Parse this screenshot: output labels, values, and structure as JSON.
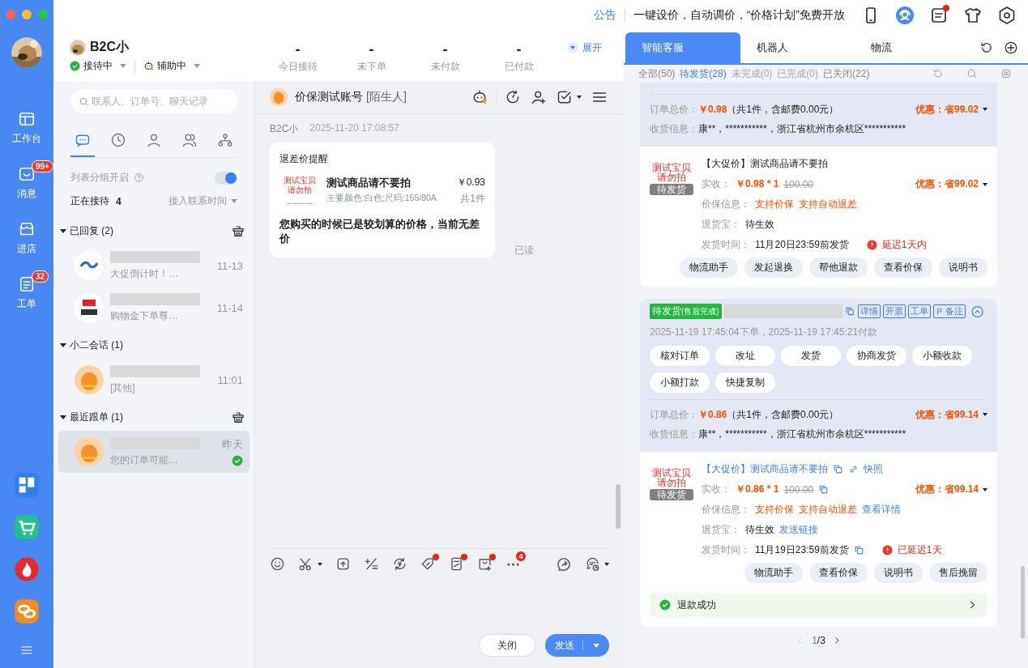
{
  "rail": {
    "items": [
      {
        "kind": "dashboard",
        "label": "工作台"
      },
      {
        "kind": "message",
        "label": "消息",
        "badge": "99+"
      },
      {
        "kind": "store",
        "label": "进店"
      },
      {
        "kind": "document",
        "label": "工单",
        "badge": "32"
      }
    ],
    "apps": [
      {
        "kind": "tiles"
      },
      {
        "kind": "cart"
      },
      {
        "kind": "fire"
      },
      {
        "kind": "chain"
      }
    ]
  },
  "topbar": {
    "link": "公告",
    "announcement": "一键设价，自动调价，“价格计划”免费开放",
    "tools": [
      {
        "kind": "phone",
        "dot": false
      },
      {
        "kind": "headset",
        "dot": false
      },
      {
        "kind": "news",
        "dot": true
      },
      {
        "kind": "shirt",
        "dot": false
      },
      {
        "kind": "settings",
        "dot": false
      }
    ]
  },
  "agent": {
    "name": "B2C小",
    "status": "接待中",
    "assist": "辅助中",
    "stats": [
      {
        "value": "-",
        "label": "今日接待"
      },
      {
        "value": "-",
        "label": "未下单"
      },
      {
        "value": "-",
        "label": "未付款"
      },
      {
        "value": "-",
        "label": "已付款"
      }
    ],
    "expand": "展开"
  },
  "contacts": {
    "search_placeholder": "联系人、订单号、聊天记录",
    "tabs": [
      {
        "kind": "chat-bubble",
        "selected": true
      },
      {
        "kind": "clock",
        "selected": false
      },
      {
        "kind": "person",
        "selected": false
      },
      {
        "kind": "people",
        "selected": false
      },
      {
        "kind": "network",
        "selected": false
      }
    ],
    "grouping": {
      "label": "列表分组开启",
      "on": true
    },
    "serving": {
      "label": "正在接待",
      "count": "4",
      "sort": "接入联系时间"
    },
    "groups": [
      {
        "title": "已回复 (2)",
        "expanded": true,
        "cleanable": true,
        "items": [
          {
            "kind": "logo-blue",
            "preview": "大促倒计时！…",
            "time": "11-13",
            "selected": false,
            "done": false
          },
          {
            "kind": "logo-red",
            "preview": "购物金下单尊…",
            "time": "11-14",
            "selected": false,
            "done": false
          }
        ]
      },
      {
        "title": "小二会话 (1)",
        "expanded": true,
        "cleanable": false,
        "items": [
          {
            "kind": "mascot",
            "preview": "[其他]",
            "time": "11:01",
            "selected": false,
            "done": false
          }
        ]
      },
      {
        "title": "最近跟单 (1)",
        "expanded": true,
        "cleanable": true,
        "items": [
          {
            "kind": "mascot",
            "preview": "您的订单可能…",
            "time": "昨天",
            "selected": true,
            "done": true
          }
        ]
      }
    ]
  },
  "chat": {
    "title": "价保测试账号",
    "tag": "[陌生人]",
    "tools": [
      {
        "kind": "robot",
        "dropdown": false
      },
      {
        "kind": "refresh",
        "dropdown": false
      },
      {
        "kind": "add-user",
        "dropdown": false
      },
      {
        "kind": "task-check",
        "dropdown": true
      },
      {
        "kind": "menu",
        "dropdown": false
      }
    ],
    "messages": [
      {
        "sender": "B2C小",
        "time": "2025-11-20 17:08:57",
        "card_title": "退差价提醒",
        "product": {
          "thumb_lines": [
            "测试宝贝",
            "请勿拍"
          ],
          "name": "测试商品请不要拍",
          "spec": "主要颜色:白色;尺码:155/80A",
          "price": "￥0.93",
          "qty": "共1件"
        },
        "text": "您购买的时候已是较划算的价格，当前无差价",
        "status": "已读"
      }
    ],
    "composer_tools": [
      {
        "kind": "smile",
        "dropdown": false,
        "dot": false
      },
      {
        "kind": "scissors",
        "dropdown": true,
        "dot": false
      },
      {
        "kind": "upload",
        "dropdown": false,
        "dot": false
      },
      {
        "kind": "calculator",
        "dropdown": false,
        "dot": false
      },
      {
        "kind": "exchange",
        "dropdown": false,
        "dot": false
      },
      {
        "kind": "tag",
        "dropdown": false,
        "dot": true
      },
      {
        "kind": "receipt",
        "dropdown": false,
        "dot": true
      },
      {
        "kind": "bag",
        "dropdown": false,
        "dot": true
      },
      {
        "kind": "more",
        "dropdown": false,
        "dot": false,
        "badge": "4"
      },
      {
        "kind": "share",
        "dropdown": false,
        "dot": false
      },
      {
        "kind": "schedule",
        "dropdown": true,
        "dot": false
      }
    ],
    "buttons": [
      {
        "label": "关闭",
        "kind": "secondary",
        "dropdown": false
      },
      {
        "label": "发送",
        "kind": "primary",
        "dropdown": true
      }
    ]
  },
  "orders_panel": {
    "tabs": [
      {
        "label": "智能客服",
        "selected": true
      },
      {
        "label": "机器人",
        "selected": false
      },
      {
        "label": "物流",
        "selected": false
      }
    ],
    "actions": [
      {
        "kind": "undo"
      },
      {
        "kind": "add-circle"
      }
    ],
    "filters": [
      {
        "label": "全部(50)",
        "selected": false,
        "disabled": false
      },
      {
        "label": "待发货(28)",
        "selected": true,
        "disabled": false
      },
      {
        "label": "未完成(0)",
        "selected": false,
        "disabled": true
      },
      {
        "label": "已完成(0)",
        "selected": false,
        "disabled": true
      },
      {
        "label": "已关闭(22)",
        "selected": false,
        "disabled": false
      }
    ],
    "filter_tools": [
      {
        "kind": "undo"
      },
      {
        "kind": "search"
      },
      {
        "kind": "list"
      }
    ],
    "orders": [
      {
        "summary": {
          "total_label": "订单总价：",
          "total": "￥0.98",
          "total_note": "（共1件，含邮费0.00元）",
          "discount": "优惠：省99.02",
          "address_label": "收货信息：",
          "address": "康**，***********，浙江省杭州市余杭区***********"
        },
        "item": {
          "thumb_lines": [
            "测试宝贝",
            "请勿拍"
          ],
          "thumb_status": "待发货",
          "title": "【大促价】测试商品请不要拍",
          "title_link": false,
          "copy_icons": false,
          "paid_label": "实收：",
          "paid": "￥0.98 * 1",
          "original": "100.00",
          "discount": "优惠：省99.02",
          "protect_label": "价保信息：",
          "protect_tags": [
            "支持价保",
            "支持自动退差"
          ],
          "return_label": "退货宝：",
          "return_status": "待生效",
          "ship_label": "发货时间：",
          "ship": "11月20日23:59前发货",
          "delay": "延迟1天内",
          "buttons": [
            "物流助手",
            "发起退换",
            "帮他退款",
            "查看价保",
            "说明书"
          ]
        }
      },
      {
        "header": {
          "status": "待发货",
          "status_note": "(售后完成)",
          "tags": [
            {
              "label": "详情",
              "flag": false
            },
            {
              "label": "开票",
              "flag": false
            },
            {
              "label": "工单",
              "flag": false
            },
            {
              "label": "备注",
              "flag": true
            }
          ],
          "expanded": true,
          "times": "2025-11-19 17:45:04下单，2025-11-19 17:45:21付款",
          "ops": [
            "核对订单",
            "改址",
            "发货",
            "协商发货",
            "小额收款",
            "小额打款",
            "快捷复制"
          ]
        },
        "summary": {
          "total_label": "订单总价：",
          "total": "￥0.86",
          "total_note": "（共1件，含邮费0.00元）",
          "discount": "优惠：省99.14",
          "address_label": "收货信息：",
          "address": "康**，***********，浙江省杭州市余杭区***********"
        },
        "item": {
          "thumb_lines": [
            "测试宝贝",
            "请勿拍"
          ],
          "thumb_status": "待发货",
          "title": "【大促价】测试商品请不要拍",
          "title_link": true,
          "copy_icons": true,
          "snapshot": "快照",
          "paid_label": "实收：",
          "paid": "￥0.86 * 1",
          "original": "100.00",
          "discount": "优惠：省99.14",
          "protect_label": "价保信息：",
          "protect_tags": [
            "支持价保",
            "支持自动退差"
          ],
          "protect_link": "查看详情",
          "return_label": "退货宝：",
          "return_status": "待生效",
          "return_link": "发送链接",
          "ship_label": "发货时间：",
          "ship": "11月19日23:59前发货",
          "delay": "已延迟1天",
          "buttons": [
            "物流助手",
            "查看价保",
            "说明书",
            "售后挽留"
          ]
        },
        "refund": {
          "label": "退款成功"
        }
      }
    ],
    "pager": {
      "current": "1",
      "rest": "/3"
    }
  }
}
